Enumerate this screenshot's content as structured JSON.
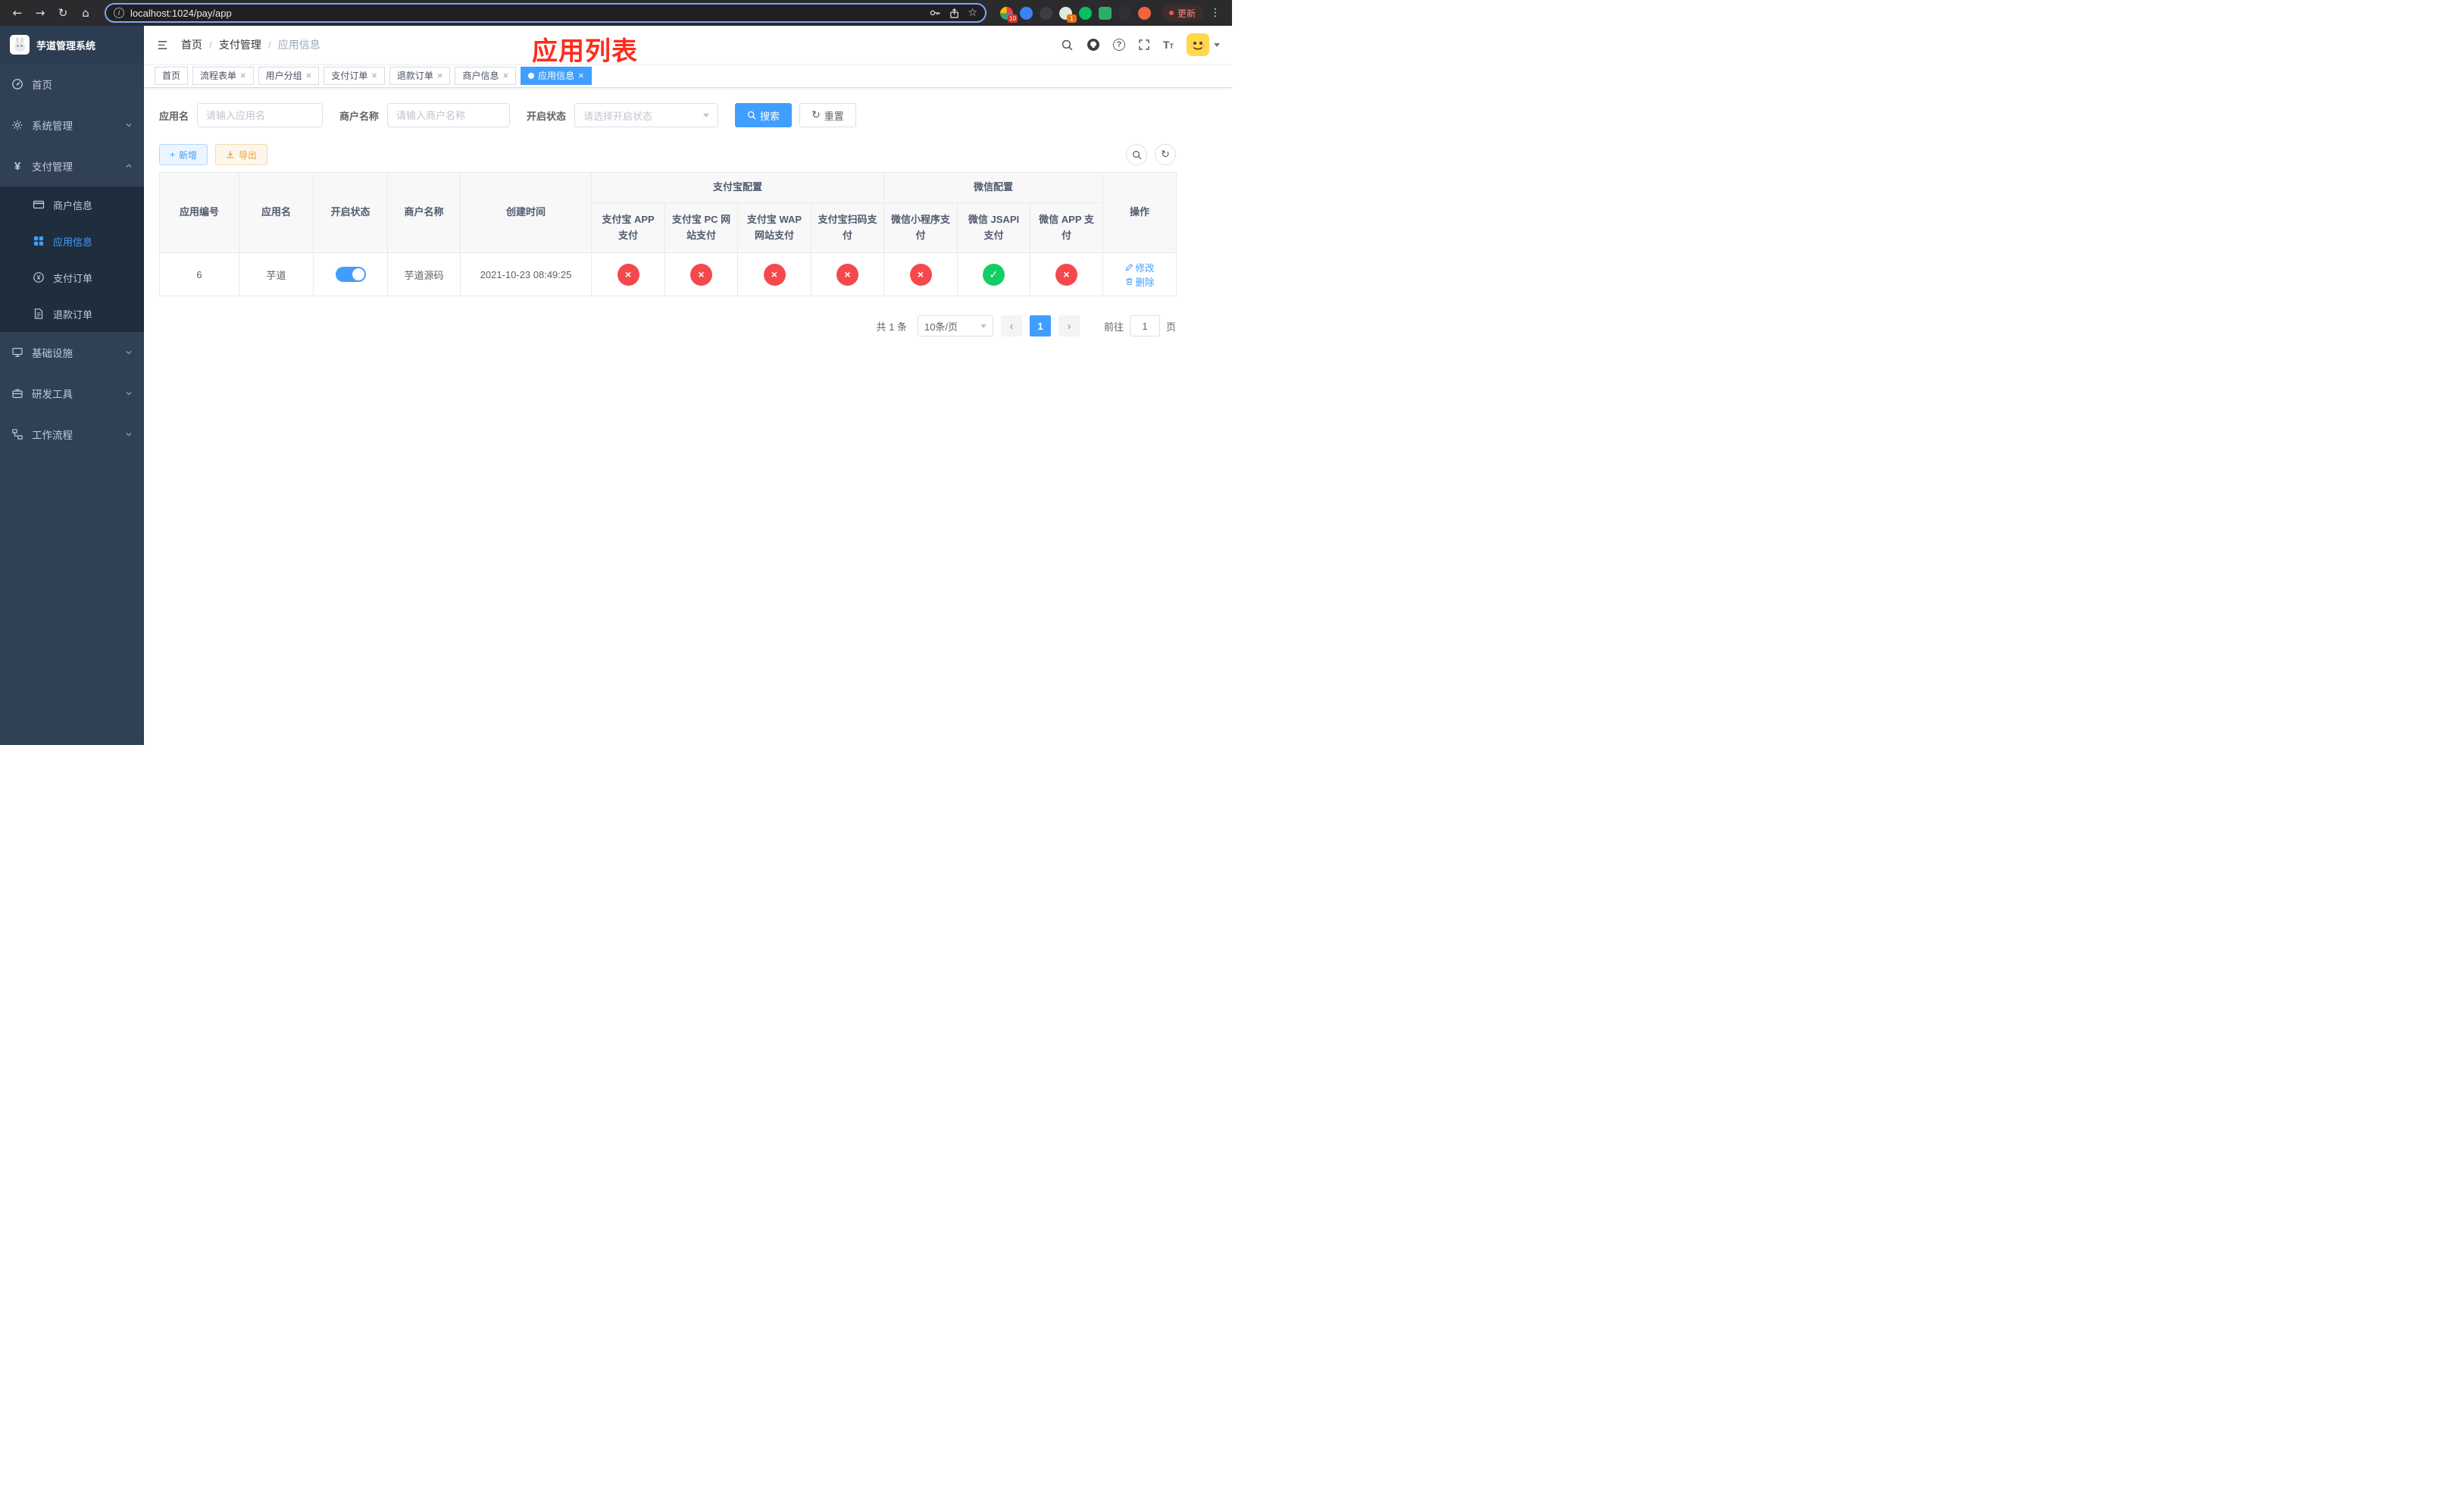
{
  "colors": {
    "accent": "#409eff",
    "danger": "#f5484d",
    "success": "#13ce66",
    "warning": "#e6a23c",
    "sidebar_bg": "#304156",
    "submenu_bg": "#1f2d3d",
    "annotation_red": "#fe2c1c"
  },
  "browser": {
    "url": "localhost:1024/pay/app",
    "update_label": "更新",
    "ext_badge_1": "10",
    "ext_badge_2": "1"
  },
  "sidebar": {
    "title": "芋道管理系统",
    "menu": {
      "home": "首页",
      "system": "系统管理",
      "payment": "支付管理",
      "merchant_info": "商户信息",
      "app_info": "应用信息",
      "pay_order": "支付订单",
      "refund_order": "退款订单",
      "infrastructure": "基础设施",
      "dev_tools": "研发工具",
      "workflow": "工作流程"
    }
  },
  "header": {
    "breadcrumb": [
      "首页",
      "支付管理",
      "应用信息"
    ],
    "annotation": "应用列表"
  },
  "tabs": [
    {
      "label": "首页"
    },
    {
      "label": "流程表单"
    },
    {
      "label": "用户分组"
    },
    {
      "label": "支付订单"
    },
    {
      "label": "退款订单"
    },
    {
      "label": "商户信息"
    },
    {
      "label": "应用信息"
    }
  ],
  "filters": {
    "app_name_label": "应用名",
    "app_name_placeholder": "请输入应用名",
    "merchant_label": "商户名称",
    "merchant_placeholder": "请输入商户名称",
    "status_label": "开启状态",
    "status_placeholder": "请选择开启状态",
    "search_button": "搜索",
    "reset_button": "重置"
  },
  "toolbar": {
    "add_button": "新增",
    "export_button": "导出"
  },
  "table": {
    "simple_columns": [
      "应用编号",
      "应用名",
      "开启状态",
      "商户名称",
      "创建时间"
    ],
    "alipay_group": {
      "title": "支付宝配置",
      "columns": [
        "支付宝 APP 支付",
        "支付宝 PC 网站支付",
        "支付宝 WAP 网站支付",
        "支付宝扫码支付"
      ]
    },
    "wechat_group": {
      "title": "微信配置",
      "columns": [
        "微信小程序支付",
        "微信 JSAPI 支付",
        "微信 APP 支付"
      ]
    },
    "action_column": "操作",
    "row": {
      "id": "6",
      "name": "芋道",
      "enabled": true,
      "merchant": "芋道源码",
      "created_at": "2021-10-23 08:49:25",
      "configs": [
        false,
        false,
        false,
        false,
        false,
        true,
        false
      ],
      "edit_label": "修改",
      "delete_label": "删除"
    }
  },
  "pagination": {
    "total": "共 1 条",
    "page_size": "10条/页",
    "current_page": "1",
    "goto_label": "前往",
    "goto_value": "1",
    "goto_suffix": "页"
  }
}
